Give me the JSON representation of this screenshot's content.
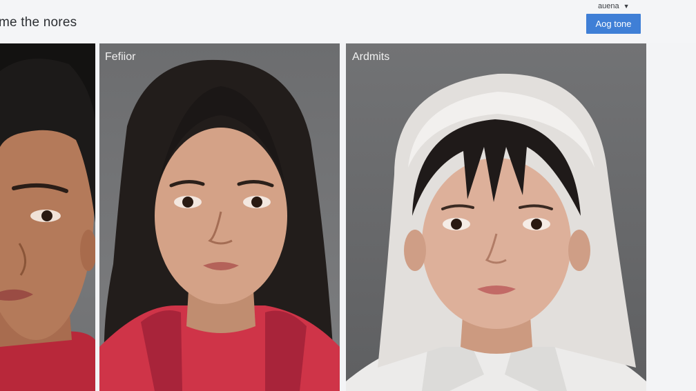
{
  "header": {
    "title": "me the nores",
    "user_menu_label": "auena",
    "action_button_label": "Aog tone"
  },
  "panels": [
    {
      "label": ""
    },
    {
      "label": "Fefiior"
    },
    {
      "label": "Ardmits"
    }
  ],
  "icons": {
    "user_menu_caret": "caret-down-icon"
  }
}
